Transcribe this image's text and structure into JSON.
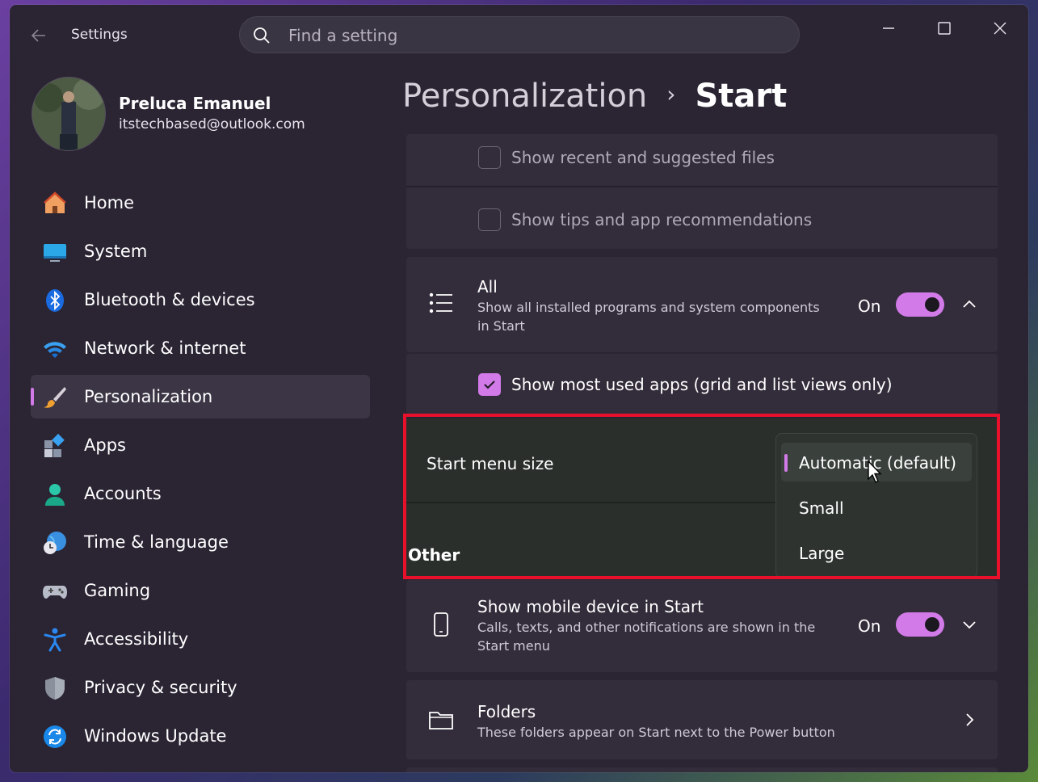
{
  "window": {
    "title": "Settings"
  },
  "search": {
    "placeholder": "Find a setting"
  },
  "profile": {
    "name": "Preluca Emanuel",
    "email": "itstechbased@outlook.com"
  },
  "nav": [
    {
      "label": "Home",
      "icon": "home-icon"
    },
    {
      "label": "System",
      "icon": "system-icon"
    },
    {
      "label": "Bluetooth & devices",
      "icon": "bluetooth-icon"
    },
    {
      "label": "Network & internet",
      "icon": "wifi-icon"
    },
    {
      "label": "Personalization",
      "icon": "paintbrush-icon",
      "active": true
    },
    {
      "label": "Apps",
      "icon": "apps-icon"
    },
    {
      "label": "Accounts",
      "icon": "accounts-icon"
    },
    {
      "label": "Time & language",
      "icon": "globe-clock-icon"
    },
    {
      "label": "Gaming",
      "icon": "gamepad-icon"
    },
    {
      "label": "Accessibility",
      "icon": "accessibility-icon"
    },
    {
      "label": "Privacy & security",
      "icon": "shield-icon"
    },
    {
      "label": "Windows Update",
      "icon": "update-icon"
    }
  ],
  "breadcrumb": {
    "parent": "Personalization",
    "separator": "›",
    "current": "Start"
  },
  "settings": {
    "recent_files": {
      "label": "Show recent and suggested files",
      "checked": false
    },
    "tips": {
      "label": "Show tips and app recommendations",
      "checked": false
    },
    "all": {
      "title": "All",
      "subtitle_line1": "Show all installed programs and system components",
      "subtitle_line2": "in Start",
      "state": "On"
    },
    "most_used": {
      "label": "Show most used apps (grid and list views only)",
      "checked": true
    },
    "menu_size": {
      "label": "Start menu size",
      "options": [
        "Automatic (default)",
        "Small",
        "Large"
      ],
      "selected": "Automatic (default)"
    },
    "other_heading": "Other",
    "mobile": {
      "title": "Show mobile device in Start",
      "subtitle_line1": "Calls, texts, and other notifications are shown in the",
      "subtitle_line2": "Start menu",
      "state": "On"
    },
    "folders": {
      "title": "Folders",
      "subtitle": "These folders appear on Start next to the Power button"
    }
  },
  "colors": {
    "accent": "#d27ae8",
    "highlight_box": "#e8102a"
  }
}
